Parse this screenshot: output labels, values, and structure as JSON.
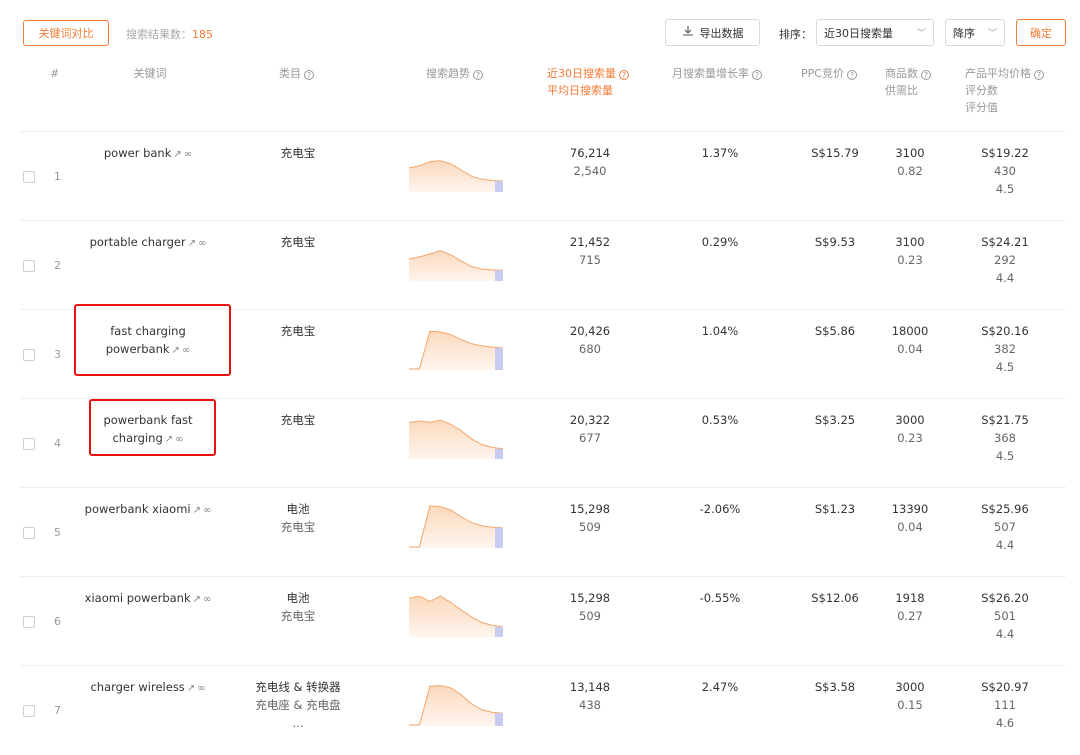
{
  "toolbar": {
    "compare_label": "关键词对比",
    "result_label": "搜索结果数：",
    "result_count": "185",
    "export_label": "导出数据",
    "sort_label": "排序：",
    "sort_field": "近30日搜索量",
    "sort_order": "降序",
    "confirm_label": "确定"
  },
  "headers": {
    "index": "#",
    "keyword": "关键词",
    "category": "类目",
    "trend": "搜索趋势",
    "volume_30d": "近30日搜索量",
    "volume_daily": "平均日搜索量",
    "growth": "月搜索量增长率",
    "ppc": "PPC竞价",
    "product_count": "商品数",
    "supply_demand": "供需比",
    "avg_price": "产品平均价格",
    "review_count": "评分数",
    "rating": "评分值"
  },
  "colors": {
    "accent": "#f37b36",
    "trend_fill_top": "#fbd9bd",
    "trend_line": "#f4a66a",
    "trend_end": "#c8ccf2",
    "highlight": "#e11111"
  },
  "rows": [
    {
      "index": "1",
      "keyword": "power bank",
      "cat1": "充电宝",
      "cat2": "",
      "cat3": "",
      "vol30": "76,214",
      "vold": "2,540",
      "growth": "1.37%",
      "ppc": "S$15.79",
      "count": "3100",
      "sd": "0.82",
      "price": "S$19.22",
      "reviews": "430",
      "rating": "4.5",
      "trend": [
        0.55,
        0.6,
        0.7,
        0.72,
        0.65,
        0.5,
        0.35,
        0.28,
        0.25,
        0.24
      ]
    },
    {
      "index": "2",
      "keyword": "portable charger",
      "cat1": "充电宝",
      "cat2": "",
      "cat3": "",
      "vol30": "21,452",
      "vold": "715",
      "growth": "0.29%",
      "ppc": "S$9.53",
      "count": "3100",
      "sd": "0.23",
      "price": "S$24.21",
      "reviews": "292",
      "rating": "4.4",
      "trend": [
        0.5,
        0.55,
        0.62,
        0.7,
        0.6,
        0.45,
        0.32,
        0.26,
        0.24,
        0.23
      ]
    },
    {
      "index": "3",
      "keyword": "fast charging powerbank",
      "cat1": "充电宝",
      "cat2": "",
      "cat3": "",
      "vol30": "20,426",
      "vold": "680",
      "growth": "1.04%",
      "ppc": "S$5.86",
      "count": "18000",
      "sd": "0.04",
      "price": "S$20.16",
      "reviews": "382",
      "rating": "4.5",
      "trend": [
        0.0,
        0.0,
        0.9,
        0.88,
        0.82,
        0.7,
        0.6,
        0.55,
        0.52,
        0.5
      ]
    },
    {
      "index": "4",
      "keyword": "powerbank fast charging",
      "cat1": "充电宝",
      "cat2": "",
      "cat3": "",
      "vol30": "20,322",
      "vold": "677",
      "growth": "0.53%",
      "ppc": "S$3.25",
      "count": "3000",
      "sd": "0.23",
      "price": "S$21.75",
      "reviews": "368",
      "rating": "4.5",
      "trend": [
        0.85,
        0.88,
        0.85,
        0.9,
        0.8,
        0.65,
        0.45,
        0.32,
        0.25,
        0.22
      ]
    },
    {
      "index": "5",
      "keyword": "powerbank xiaomi",
      "cat1": "电池",
      "cat2": "充电宝",
      "cat3": "",
      "vol30": "15,298",
      "vold": "509",
      "growth": "-2.06%",
      "ppc": "S$1.23",
      "count": "13390",
      "sd": "0.04",
      "price": "S$25.96",
      "reviews": "507",
      "rating": "4.4",
      "trend": [
        0.0,
        0.0,
        0.98,
        0.96,
        0.88,
        0.72,
        0.58,
        0.5,
        0.47,
        0.46
      ]
    },
    {
      "index": "6",
      "keyword": "xiaomi powerbank",
      "cat1": "电池",
      "cat2": "充电宝",
      "cat3": "",
      "vol30": "15,298",
      "vold": "509",
      "growth": "-0.55%",
      "ppc": "S$12.06",
      "count": "1918",
      "sd": "0.27",
      "price": "S$26.20",
      "reviews": "501",
      "rating": "4.4",
      "trend": [
        0.9,
        0.95,
        0.82,
        0.95,
        0.8,
        0.62,
        0.45,
        0.32,
        0.25,
        0.22
      ]
    },
    {
      "index": "7",
      "keyword": "charger wireless",
      "cat1": "充电线 & 转换器",
      "cat2": "充电座 & 充电盘",
      "cat3": "...",
      "vol30": "13,148",
      "vold": "438",
      "growth": "2.47%",
      "ppc": "S$3.58",
      "count": "3000",
      "sd": "0.15",
      "price": "S$20.97",
      "reviews": "111",
      "rating": "4.6",
      "trend": [
        0.0,
        0.0,
        0.92,
        0.94,
        0.88,
        0.72,
        0.5,
        0.36,
        0.3,
        0.28
      ]
    }
  ]
}
